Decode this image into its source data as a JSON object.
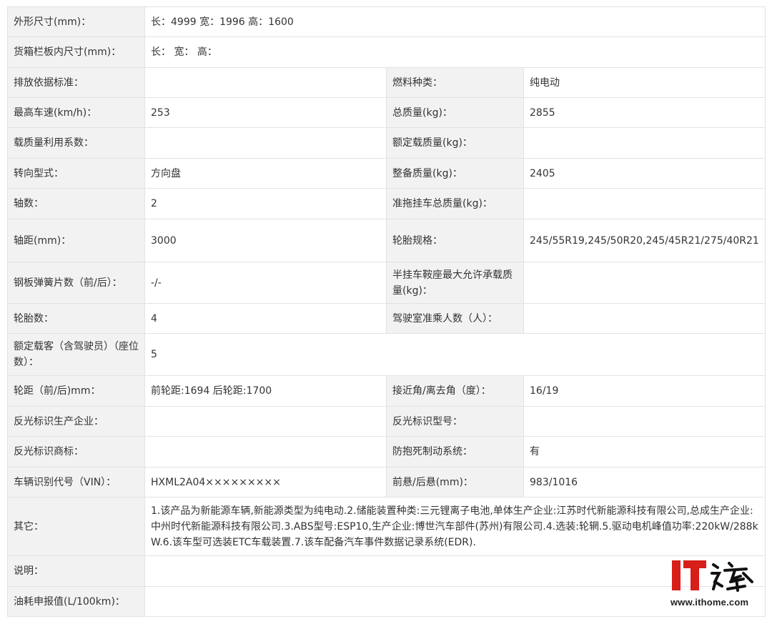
{
  "rows": {
    "dimensions": {
      "label": "外形尺寸(mm)：",
      "value": "长：4999 宽：1996 高：1600"
    },
    "cargo": {
      "label": "货箱栏板内尺寸(mm)：",
      "value": "长： 宽： 高："
    },
    "emission": {
      "label": "排放依据标准：",
      "value": "",
      "label2": "燃料种类：",
      "value2": "纯电动"
    },
    "max_speed": {
      "label": "最高车速(km/h)：",
      "value": "253",
      "label2": "总质量(kg)：",
      "value2": "2855"
    },
    "load_factor": {
      "label": "载质量利用系数：",
      "value": "",
      "label2": "额定载质量(kg)：",
      "value2": ""
    },
    "steering": {
      "label": "转向型式：",
      "value": "方向盘",
      "label2": "整备质量(kg)：",
      "value2": "2405"
    },
    "axles": {
      "label": "轴数：",
      "value": "2",
      "label2": "准拖挂车总质量(kg)：",
      "value2": ""
    },
    "wheelbase": {
      "label": "轴距(mm)：",
      "value": "3000",
      "label2": "轮胎规格：",
      "value2": "245/55R19,245/50R20,245/45R21/275/40R21"
    },
    "leaf_spring": {
      "label": "钢板弹簧片数（前/后）：",
      "value": "-/-",
      "label2": "半挂车鞍座最大允许承载质量(kg)：",
      "value2": ""
    },
    "tires": {
      "label": "轮胎数：",
      "value": "4",
      "label2": "驾驶室准乘人数（人）：",
      "value2": ""
    },
    "passengers": {
      "label": "额定载客（含驾驶员）（座位数）：",
      "value": "5"
    },
    "track": {
      "label": "轮距（前/后)mm：",
      "value": "前轮距:1694 后轮距:1700",
      "label2": "接近角/离去角（度）：",
      "value2": "16/19"
    },
    "reflector_maker": {
      "label": "反光标识生产企业：",
      "value": "",
      "label2": "反光标识型号：",
      "value2": ""
    },
    "reflector_brand": {
      "label": "反光标识商标：",
      "value": "",
      "label2": "防抱死制动系统：",
      "value2": "有"
    },
    "vin": {
      "label": "车辆识别代号（VIN）：",
      "value": "HXML2A04×××××××××",
      "label2": "前悬/后悬(mm)：",
      "value2": "983/1016"
    },
    "other": {
      "label": "其它：",
      "value": "1.该产品为新能源车辆,新能源类型为纯电动.2.储能装置种类:三元锂离子电池,单体生产企业:江苏时代新能源科技有限公司,总成生产企业:中州时代新能源科技有限公司.3.ABS型号:ESP10,生产企业:博世汽车部件(苏州)有限公司.4.选装:轮辋.5.驱动电机峰值功率:220kW/288kW.6.该车型可选装ETC车载装置.7.该车配备汽车事件数据记录系统(EDR)."
    },
    "notes": {
      "label": "说明：",
      "value": ""
    },
    "fuel": {
      "label": "油耗申报值(L/100km)：",
      "value": ""
    }
  },
  "watermark": {
    "logo_text": "IT之家",
    "url": "www.ithome.com",
    "logo_color": "#d71e18"
  }
}
